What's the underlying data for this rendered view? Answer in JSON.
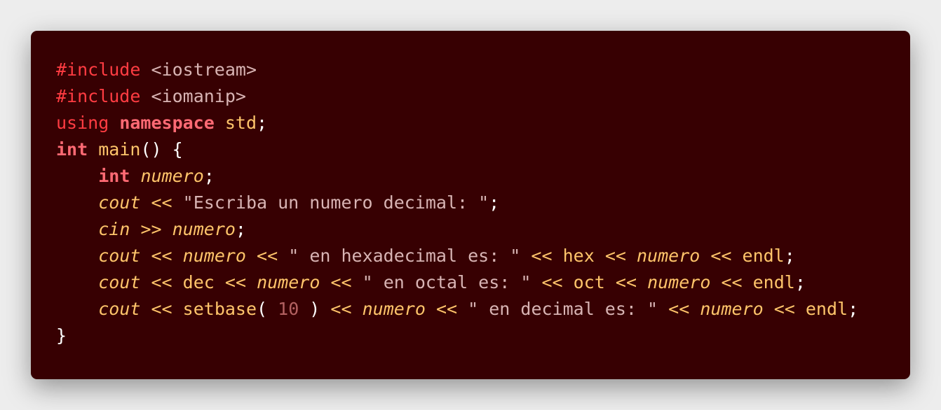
{
  "colors": {
    "page_background": "#ededed",
    "editor_background": "#370002",
    "directive": "#ff3c42",
    "header_and_string": "#d8b4b4",
    "keyword": "#ff6a74",
    "identifier": "#ffc56b",
    "number": "#b36161",
    "punctuation": "#ffffff"
  },
  "code": {
    "language": "C++",
    "lines": [
      [
        {
          "text": "#include",
          "kind": "directive"
        },
        {
          "text": " ",
          "kind": "plain"
        },
        {
          "text": "<iostream>",
          "kind": "header"
        }
      ],
      [
        {
          "text": "#include",
          "kind": "directive"
        },
        {
          "text": " ",
          "kind": "plain"
        },
        {
          "text": "<iomanip>",
          "kind": "header"
        }
      ],
      [
        {
          "text": "using",
          "kind": "directive"
        },
        {
          "text": " ",
          "kind": "plain"
        },
        {
          "text": "namespace",
          "kind": "keyword_bold"
        },
        {
          "text": " ",
          "kind": "plain"
        },
        {
          "text": "std",
          "kind": "ident"
        },
        {
          "text": ";",
          "kind": "punct"
        }
      ],
      [
        {
          "text": "int",
          "kind": "keyword_bold"
        },
        {
          "text": " ",
          "kind": "plain"
        },
        {
          "text": "main",
          "kind": "ident"
        },
        {
          "text": "() {",
          "kind": "punct"
        }
      ],
      [
        {
          "text": "    ",
          "kind": "plain"
        },
        {
          "text": "int",
          "kind": "keyword_bold"
        },
        {
          "text": " ",
          "kind": "plain"
        },
        {
          "text": "numero",
          "kind": "ident_italic"
        },
        {
          "text": ";",
          "kind": "punct"
        }
      ],
      [
        {
          "text": "    ",
          "kind": "plain"
        },
        {
          "text": "cout",
          "kind": "ident_italic"
        },
        {
          "text": " ",
          "kind": "plain"
        },
        {
          "text": "<<",
          "kind": "op"
        },
        {
          "text": " ",
          "kind": "plain"
        },
        {
          "text": "\"Escriba un numero decimal: \"",
          "kind": "string"
        },
        {
          "text": ";",
          "kind": "punct"
        }
      ],
      [
        {
          "text": "    ",
          "kind": "plain"
        },
        {
          "text": "cin",
          "kind": "ident_italic"
        },
        {
          "text": " ",
          "kind": "plain"
        },
        {
          "text": ">>",
          "kind": "op"
        },
        {
          "text": " ",
          "kind": "plain"
        },
        {
          "text": "numero",
          "kind": "ident_italic"
        },
        {
          "text": ";",
          "kind": "punct"
        }
      ],
      [
        {
          "text": "    ",
          "kind": "plain"
        },
        {
          "text": "cout",
          "kind": "ident_italic"
        },
        {
          "text": " ",
          "kind": "plain"
        },
        {
          "text": "<<",
          "kind": "op"
        },
        {
          "text": " ",
          "kind": "plain"
        },
        {
          "text": "numero",
          "kind": "ident_italic"
        },
        {
          "text": " ",
          "kind": "plain"
        },
        {
          "text": "<<",
          "kind": "op"
        },
        {
          "text": " ",
          "kind": "plain"
        },
        {
          "text": "\" en hexadecimal es: \"",
          "kind": "string"
        },
        {
          "text": " ",
          "kind": "plain"
        },
        {
          "text": "<<",
          "kind": "op"
        },
        {
          "text": " ",
          "kind": "plain"
        },
        {
          "text": "hex",
          "kind": "ident"
        },
        {
          "text": " ",
          "kind": "plain"
        },
        {
          "text": "<<",
          "kind": "op"
        },
        {
          "text": " ",
          "kind": "plain"
        },
        {
          "text": "numero",
          "kind": "ident_italic"
        },
        {
          "text": " ",
          "kind": "plain"
        },
        {
          "text": "<<",
          "kind": "op"
        },
        {
          "text": " ",
          "kind": "plain"
        },
        {
          "text": "endl",
          "kind": "ident"
        },
        {
          "text": ";",
          "kind": "punct"
        }
      ],
      [
        {
          "text": "    ",
          "kind": "plain"
        },
        {
          "text": "cout",
          "kind": "ident_italic"
        },
        {
          "text": " ",
          "kind": "plain"
        },
        {
          "text": "<<",
          "kind": "op"
        },
        {
          "text": " ",
          "kind": "plain"
        },
        {
          "text": "dec",
          "kind": "ident"
        },
        {
          "text": " ",
          "kind": "plain"
        },
        {
          "text": "<<",
          "kind": "op"
        },
        {
          "text": " ",
          "kind": "plain"
        },
        {
          "text": "numero",
          "kind": "ident_italic"
        },
        {
          "text": " ",
          "kind": "plain"
        },
        {
          "text": "<<",
          "kind": "op"
        },
        {
          "text": " ",
          "kind": "plain"
        },
        {
          "text": "\" en octal es: \"",
          "kind": "string"
        },
        {
          "text": " ",
          "kind": "plain"
        },
        {
          "text": "<<",
          "kind": "op"
        },
        {
          "text": " ",
          "kind": "plain"
        },
        {
          "text": "oct",
          "kind": "ident"
        },
        {
          "text": " ",
          "kind": "plain"
        },
        {
          "text": "<<",
          "kind": "op"
        },
        {
          "text": " ",
          "kind": "plain"
        },
        {
          "text": "numero",
          "kind": "ident_italic"
        },
        {
          "text": " ",
          "kind": "plain"
        },
        {
          "text": "<<",
          "kind": "op"
        },
        {
          "text": " ",
          "kind": "plain"
        },
        {
          "text": "endl",
          "kind": "ident"
        },
        {
          "text": ";",
          "kind": "punct"
        }
      ],
      [
        {
          "text": "    ",
          "kind": "plain"
        },
        {
          "text": "cout",
          "kind": "ident_italic"
        },
        {
          "text": " ",
          "kind": "plain"
        },
        {
          "text": "<<",
          "kind": "op"
        },
        {
          "text": " ",
          "kind": "plain"
        },
        {
          "text": "setbase",
          "kind": "ident"
        },
        {
          "text": "( ",
          "kind": "punct"
        },
        {
          "text": "10",
          "kind": "number"
        },
        {
          "text": " )",
          "kind": "punct"
        },
        {
          "text": " ",
          "kind": "plain"
        },
        {
          "text": "<<",
          "kind": "op"
        },
        {
          "text": " ",
          "kind": "plain"
        },
        {
          "text": "numero",
          "kind": "ident_italic"
        },
        {
          "text": " ",
          "kind": "plain"
        },
        {
          "text": "<<",
          "kind": "op"
        },
        {
          "text": " ",
          "kind": "plain"
        },
        {
          "text": "\" en decimal es: \"",
          "kind": "string"
        },
        {
          "text": " ",
          "kind": "plain"
        },
        {
          "text": "<<",
          "kind": "op"
        },
        {
          "text": " ",
          "kind": "plain"
        },
        {
          "text": "numero",
          "kind": "ident_italic"
        },
        {
          "text": " ",
          "kind": "plain"
        },
        {
          "text": "<<",
          "kind": "op"
        },
        {
          "text": " ",
          "kind": "plain"
        },
        {
          "text": "endl",
          "kind": "ident"
        },
        {
          "text": ";",
          "kind": "punct"
        }
      ],
      [
        {
          "text": "}",
          "kind": "punct"
        }
      ]
    ]
  }
}
